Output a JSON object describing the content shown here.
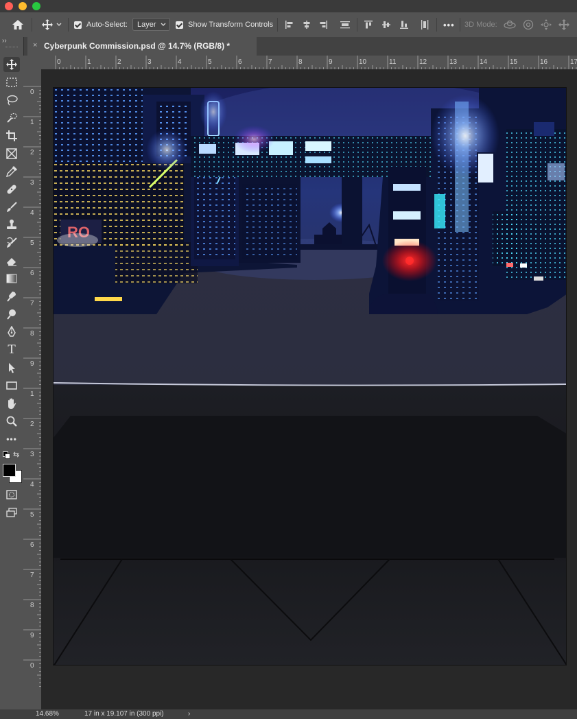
{
  "window": {
    "traffic_lights": [
      "#fe5f57",
      "#febc2e",
      "#28c840"
    ]
  },
  "options_bar": {
    "home_icon": "home-icon",
    "move_tool_icon": "move-icon",
    "auto_select_label": "Auto-Select:",
    "auto_select_checked": true,
    "auto_select_value": "Layer",
    "show_transform_label": "Show Transform Controls",
    "show_transform_checked": true,
    "more_label": "•••",
    "mode_3d_label": "3D Mode:"
  },
  "document_tab": {
    "close_label": "×",
    "title": "Cyberpunk Commission.psd @ 14.7% (RGB/8) *"
  },
  "tools": [
    "move-tool",
    "rectangular-marquee-tool",
    "lasso-tool",
    "object-selection-tool",
    "crop-tool",
    "frame-tool",
    "eyedropper-tool",
    "spot-healing-tool",
    "brush-tool",
    "clone-stamp-tool",
    "history-brush-tool",
    "eraser-tool",
    "gradient-tool",
    "smudge-tool",
    "dodge-tool",
    "pen-tool",
    "type-tool",
    "path-selection-tool",
    "rectangle-tool",
    "hand-tool",
    "zoom-tool",
    "edit-toolbar",
    "color-swatches",
    "quick-mask",
    "screen-mode"
  ],
  "type_tool_label": "T",
  "toolbar_more_label": "•••",
  "ruler": {
    "h_labels": [
      "0",
      "1",
      "2",
      "3",
      "4",
      "5",
      "6",
      "7",
      "8",
      "9",
      "10",
      "11",
      "12",
      "13",
      "14",
      "15",
      "16",
      "17"
    ],
    "v_labels": [
      "0",
      "1",
      "2",
      "3",
      "4",
      "5",
      "6",
      "7",
      "8",
      "9",
      "1",
      "2",
      "3",
      "4",
      "5",
      "6",
      "7",
      "8",
      "9",
      "0"
    ]
  },
  "colors": {
    "foreground": "#000000",
    "background": "#ffffff",
    "accent_red": "#ff2a2a",
    "neon_blue": "#3a6bff"
  },
  "status_bar": {
    "zoom": "14.68%",
    "doc_info": "17 in x 19.107 in (300 ppi)",
    "arrow": "›"
  }
}
